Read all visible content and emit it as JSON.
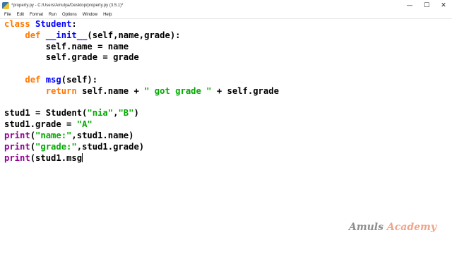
{
  "window": {
    "title": "*property.py - C:/Users/Amulya/Desktop/property.py (3.5.1)*",
    "controls": {
      "minimize": "—",
      "maximize": "☐",
      "close": "✕"
    }
  },
  "menu": [
    "File",
    "Edit",
    "Format",
    "Run",
    "Options",
    "Window",
    "Help"
  ],
  "code": {
    "l1": {
      "kw": "class",
      "name": "Student",
      "rest": ":"
    },
    "l2": {
      "indent": "    ",
      "kw": "def",
      "name": "__init__",
      "rest": "(self,name,grade):"
    },
    "l3": {
      "text": "        self.name = name"
    },
    "l4": {
      "text": "        self.grade = grade"
    },
    "l6": {
      "indent": "    ",
      "kw": "def",
      "name": "msg",
      "rest": "(self):"
    },
    "l7": {
      "indent": "        ",
      "kw": "return",
      "a": " self.name + ",
      "s1": "\" got grade \"",
      "b": " + self.grade"
    },
    "l9": {
      "a": "stud1 = Student(",
      "s1": "\"nia\"",
      "c": ",",
      "s2": "\"B\"",
      "d": ")"
    },
    "l10": {
      "a": "stud1.grade = ",
      "s1": "\"A\""
    },
    "l11": {
      "bi": "print",
      "a": "(",
      "s1": "\"name:\"",
      "b": ",stud1.name)"
    },
    "l12": {
      "bi": "print",
      "a": "(",
      "s1": "\"grade:\"",
      "b": ",stud1.grade)"
    },
    "l13": {
      "bi": "print",
      "a": "(stud1.msg"
    }
  },
  "watermark": {
    "part1": "Amuls ",
    "part2": "Academy"
  }
}
